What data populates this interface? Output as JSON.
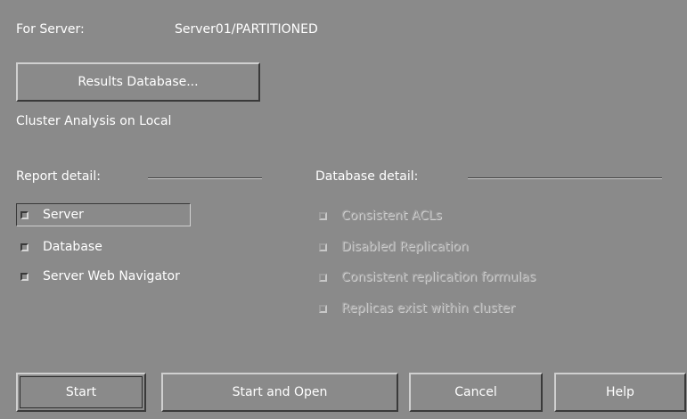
{
  "header": {
    "server_label": "For Server:",
    "server_value": "Server01/PARTITIONED"
  },
  "results_button_label": "Results Database...",
  "cluster_analysis_text": "Cluster Analysis on Local",
  "report_detail": {
    "label": "Report detail:",
    "options": [
      {
        "label": "Server",
        "checked": false,
        "enabled": true
      },
      {
        "label": "Database",
        "checked": false,
        "enabled": true
      },
      {
        "label": "Server Web Navigator",
        "checked": false,
        "enabled": true
      }
    ]
  },
  "database_detail": {
    "label": "Database detail:",
    "options": [
      {
        "label": "Consistent ACLs",
        "checked": false,
        "enabled": false
      },
      {
        "label": "Disabled Replication",
        "checked": false,
        "enabled": false
      },
      {
        "label": "Consistent replication formulas",
        "checked": false,
        "enabled": false
      },
      {
        "label": "Replicas exist within cluster",
        "checked": false,
        "enabled": false
      }
    ]
  },
  "buttons": {
    "start": "Start",
    "start_and_open": "Start and Open",
    "cancel": "Cancel",
    "help": "Help"
  },
  "colors": {
    "background": "#8a8a8a",
    "text": "#ffffff",
    "disabled_text": "#a0a0a0"
  }
}
